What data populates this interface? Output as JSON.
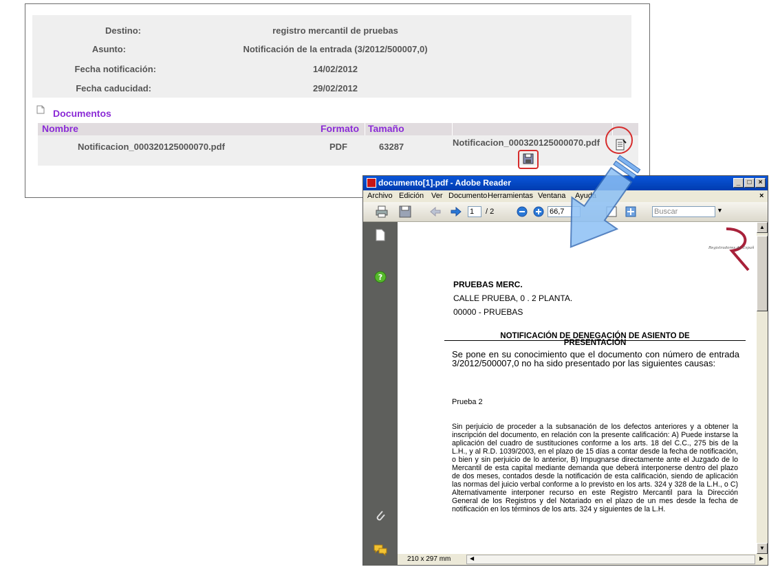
{
  "info": {
    "destino_label": "Destino:",
    "destino_value": "registro mercantil de pruebas",
    "asunto_label": "Asunto:",
    "asunto_value": "Notificación de la entrada (3/2012/500007,0)",
    "fecha_notif_label": "Fecha notificación:",
    "fecha_notif_value": "14/02/2012",
    "fecha_cad_label": "Fecha caducidad:",
    "fecha_cad_value": "29/02/2012"
  },
  "documents": {
    "heading": "Documentos",
    "columns": [
      "Nombre",
      "Formato",
      "Tamaño"
    ],
    "row": {
      "nombre": "Notificacion_000320125000070.pdf",
      "formato": "PDF",
      "tamano": "63287",
      "attachment_name": "Notificacion_000320125000070.pdf"
    }
  },
  "reader": {
    "title": "documento[1].pdf - Adobe Reader",
    "menu": [
      "Archivo",
      "Edición",
      "Ver",
      "Documento",
      "Herramientas",
      "Ventana",
      "Ayuda"
    ],
    "page_current": "1",
    "page_total": "/ 2",
    "zoom": "66,7",
    "search_placeholder": "Buscar",
    "status_size": "210 x 297 mm"
  },
  "pdf": {
    "logo_text": "Registradores de España",
    "addressee_name": "PRUEBAS MERC.",
    "addressee_street": "CALLE PRUEBA, 0   . 2 PLANTA.",
    "addressee_city": "00000 - PRUEBAS",
    "heading_line1": "NOTIFICACIÓN DE DENEGACIÓN DE ASIENTO DE",
    "heading_line2": "PRESENTACIÓN",
    "notice": "Se pone en su conocimiento que el documento con número de entrada 3/2012/500007,0 no ha sido presentado por las siguientes causas:",
    "cause": "Prueba 2",
    "body": "Sin perjuicio de proceder a la subsanación de los defectos anteriores y a obtener la inscripción del documento, en relación con la presente calificación: A) Puede instarse la aplicación del cuadro de sustituciones conforme a los arts. 18 del C.C., 275 bis de la L.H., y al R.D. 1039/2003, en el plazo de 15 días a contar desde la fecha de notificación, o bien y sin perjuicio de lo anterior, B) Impugnarse directamente ante el Juzgado de lo Mercantil de esta capital mediante demanda que deberá interponerse dentro del plazo de dos meses, contados desde la notificación de esta calificación, siendo de aplicación las normas del juicio verbal conforme a lo previsto en los arts. 324 y 328 de la L.H., o C) Alternativamente interponer recurso en este Registro Mercantil para la Dirección General de los Registros y del Notariado en el plazo de un mes desde la fecha de notificación en los términos de los arts. 324 y siguientes de la L.H."
  }
}
